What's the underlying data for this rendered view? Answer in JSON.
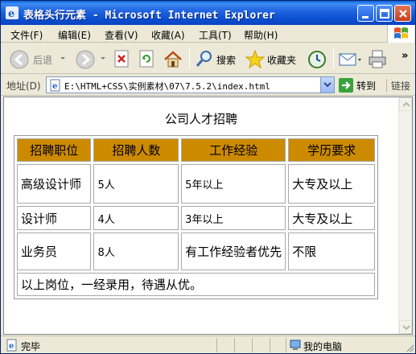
{
  "window": {
    "title": "表格头行元素 - Microsoft Internet Explorer"
  },
  "menu": {
    "items": [
      {
        "label": "文件(F)"
      },
      {
        "label": "编辑(E)"
      },
      {
        "label": "查看(V)"
      },
      {
        "label": "收藏(A)"
      },
      {
        "label": "工具(T)"
      },
      {
        "label": "帮助(H)"
      }
    ]
  },
  "toolbar": {
    "back_label": "后退",
    "search_label": "搜索",
    "favorites_label": "收藏夹",
    "overflow": "»"
  },
  "address": {
    "label": "地址(D)",
    "url": "E:\\HTML+CSS\\实例素材\\07\\7.5.2\\index.html",
    "go_label": "转到",
    "links_label": "链接"
  },
  "page": {
    "heading": "公司人才招聘",
    "table": {
      "headers": [
        "招聘职位",
        "招聘人数",
        "工作经验",
        "学历要求"
      ],
      "rows": [
        [
          "高级设计师",
          "5人",
          "5年以上",
          "大专及以上"
        ],
        [
          "设计师",
          "4人",
          "3年以上",
          "大专及以上"
        ],
        [
          "业务员",
          "8人",
          "有工作经验者优先",
          "不限"
        ]
      ],
      "footer": "以上岗位，一经录用，待遇从优。"
    }
  },
  "status": {
    "text": "完毕",
    "zone": "我的电脑"
  },
  "colors": {
    "header_bg": "#cc8a00",
    "titlebar": "#0b4fd1"
  }
}
